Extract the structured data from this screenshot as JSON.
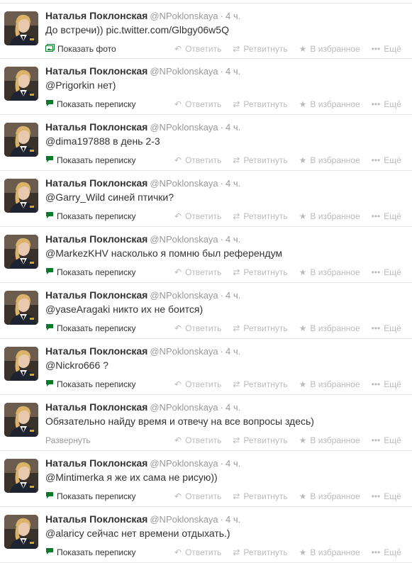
{
  "tweets": [
    {
      "name": "Наталья Поклонская",
      "username": "@NPoklonskaya",
      "time": "4 ч.",
      "text_prefix": "До встречи)) ",
      "text_link": "pic.twitter.com/Glbgy06w5Q",
      "text_rest": "",
      "detail_icon": "photo-icon",
      "detail": "Показать фото"
    },
    {
      "name": "Наталья Поклонская",
      "username": "@NPoklonskaya",
      "time": "4 ч.",
      "text_prefix": "",
      "text_link": "@Prigorkin",
      "text_rest": " нет)",
      "detail_icon": "conversation-icon",
      "detail": "Показать переписку"
    },
    {
      "name": "Наталья Поклонская",
      "username": "@NPoklonskaya",
      "time": "4 ч.",
      "text_prefix": "",
      "text_link": "@dima197888",
      "text_rest": " в день 2-3",
      "detail_icon": "conversation-icon",
      "detail": "Показать переписку"
    },
    {
      "name": "Наталья Поклонская",
      "username": "@NPoklonskaya",
      "time": "4 ч.",
      "text_prefix": "",
      "text_link": "@Garry_Wild",
      "text_rest": " синей птички?",
      "detail_icon": "conversation-icon",
      "detail": "Показать переписку"
    },
    {
      "name": "Наталья Поклонская",
      "username": "@NPoklonskaya",
      "time": "4 ч.",
      "text_prefix": "",
      "text_link": "@MarkezKHV",
      "text_rest": " насколько я помню был референдум",
      "detail_icon": "conversation-icon",
      "detail": "Показать переписку"
    },
    {
      "name": "Наталья Поклонская",
      "username": "@NPoklonskaya",
      "time": "4 ч.",
      "text_prefix": "",
      "text_link": "@yaseAragaki",
      "text_rest": " никто их не боится)",
      "detail_icon": "conversation-icon",
      "detail": "Показать переписку"
    },
    {
      "name": "Наталья Поклонская",
      "username": "@NPoklonskaya",
      "time": "4 ч.",
      "text_prefix": "",
      "text_link": "@Nickro666",
      "text_rest": " ?",
      "detail_icon": "conversation-icon",
      "detail": "Показать переписку"
    },
    {
      "name": "Наталья Поклонская",
      "username": "@NPoklonskaya",
      "time": "4 ч.",
      "text_prefix": "Обязательно найду время и отвечу на все вопросы здесь)",
      "text_link": "",
      "text_rest": "",
      "detail_icon": "",
      "detail": "Развернуть"
    },
    {
      "name": "Наталья Поклонская",
      "username": "@NPoklonskaya",
      "time": "4 ч.",
      "text_prefix": "",
      "text_link": "@Mintimerka",
      "text_rest": " я же их сама не рисую))",
      "detail_icon": "conversation-icon",
      "detail": "Показать переписку"
    },
    {
      "name": "Наталья Поклонская",
      "username": "@NPoklonskaya",
      "time": "4 ч.",
      "text_prefix": "",
      "text_link": "@alaricy",
      "text_rest": " сейчас нет времени отдыхать.)",
      "detail_icon": "conversation-icon",
      "detail": "Показать переписку"
    }
  ],
  "actions": {
    "reply": "Ответить",
    "retweet": "Ретвитнуть",
    "favorite": "В избранное",
    "more": "Ещё"
  },
  "icons": {
    "reply": "reply-icon",
    "retweet": "retweet-icon",
    "favorite": "star-icon",
    "more": "more-dots-icon"
  },
  "colors": {
    "detail_icon": "#0a7a2a",
    "muted": "#999999",
    "action": "#bbbbbb"
  }
}
